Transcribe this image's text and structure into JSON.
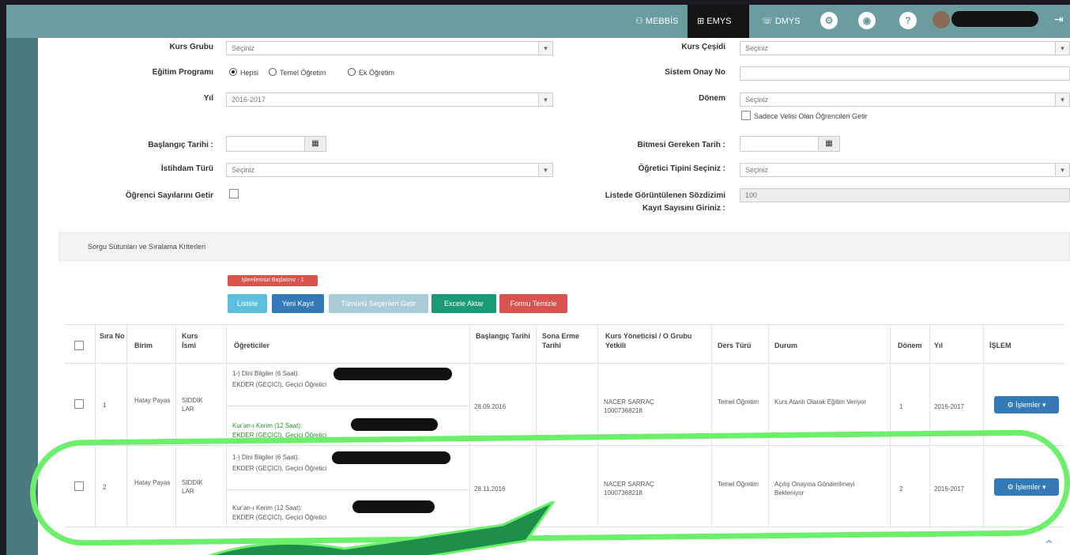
{
  "topbar": {
    "tabs": [
      {
        "label": "MEBBİS",
        "icon": "user-icon"
      },
      {
        "label": "EMYS",
        "icon": "graduation-cap-icon"
      },
      {
        "label": "DMYS",
        "icon": "phone-icon"
      }
    ]
  },
  "form": {
    "kurs_grubu_label": "Kurs Grubu",
    "kurs_grubu_value": "Seçiniz",
    "kurs_cesidi_label": "Kurs Çeşidi",
    "kurs_cesidi_value": "Seçiniz",
    "egitim_programi_label": "Eğitim Programı",
    "radio_options": [
      "Hepsi",
      "Temel Öğretim",
      "Ek Öğretim"
    ],
    "sistem_onay_label": "Sistem Onay No",
    "yil_label": "Yıl",
    "yil_value": "2016-2017",
    "donem_label": "Dönem",
    "donem_value": "Seçiniz",
    "sadece_label": "Sadece Velisi Olan Öğrencileri Getir",
    "baslangic_label": "Başlangıç Tarihi :",
    "bitmesi_label": "Bitmesi Gereken Tarih :",
    "istihdam_label": "İstihdam Türü",
    "istihdam_value": "Seçiniz",
    "ogretici_label": "Öğretici Tipini Seçiniz :",
    "ogretici_value": "Seçiniz",
    "ogrenci_label": "Öğrenci Sayılarını Getir",
    "listede_label_1": "Listede Görüntülenen Sözdizimi",
    "listede_label_2": "Kayıt Sayısını Giriniz :",
    "listede_value": "100"
  },
  "sorgu_label": "Sorgu Sütunları ve Sıralama Kriterleri",
  "buttons": {
    "warning": "İşlemlerinizi Başlatınız - 1",
    "listele": "Listele",
    "yeni_kayit": "Yeni Kayıt",
    "tumunu": "Tümünü Seçenleri Getir",
    "excel": "Excele Aktar",
    "temizle": "Formu Temizle"
  },
  "table": {
    "headers": [
      "Sıra No",
      "Birim",
      "Kurs İsmi",
      "Öğreticiler",
      "Başlangıç Tarihi",
      "Sona Erme Tarihi",
      "Kurs Yöneticisi / O Grubu Yetkili",
      "Ders Türü",
      "Durum",
      "Dönem",
      "Yıl",
      "İŞLEM"
    ],
    "rows": [
      {
        "no": "1",
        "birim": "Hatay Payas",
        "kurs": "SIDDIK LAR",
        "ogretici_1": "1-) Dini Bilgiler (6 Saat):",
        "ogretici_1b": "EKDER (GEÇİCİ), Geçici Öğretici",
        "ogretici_2": "Kur'an-ı Kerim (12 Saat):",
        "ogretici_2b": "EKDER (GEÇİCİ), Geçici Öğretici",
        "baslangic": "28.09.2016",
        "bitis": "",
        "yonetici": "NACER SARRAÇ",
        "yonetici_no": "10007368218",
        "ders_turu": "Temel Öğretim",
        "durum": "Kurs Atanlı Olarak Eğitim Veriyor",
        "donem": "1",
        "yil": "2016-2017",
        "islem": "İşlemler"
      },
      {
        "no": "2",
        "birim": "Hatay Payas",
        "kurs": "SIDDIK LAR",
        "ogretici_1": "1-) Dini Bilgiler (6 Saat):",
        "ogretici_1b": "EKDER (GEÇİCİ), Geçici Öğretici",
        "ogretici_2": "Kur'an-ı Kerim (12 Saat):",
        "ogretici_2b": "EKDER (GEÇİCİ), Geçici Öğretici",
        "baslangic": "28.11.2016",
        "bitis": "",
        "yonetici": "NACER SARRAÇ",
        "yonetici_no": "10007368218",
        "ders_turu": "Temel Öğretim",
        "durum": "Açılış Onayına Gönderilmeyi Bekleniyor",
        "donem": "2",
        "yil": "2016-2017",
        "islem": "İşlemler"
      }
    ]
  },
  "colors": {
    "topbar": "#6b9da0",
    "highlight": "#6cf06c",
    "primary": "#337ab7",
    "danger": "#d9534f",
    "success": "#1a9a75"
  }
}
